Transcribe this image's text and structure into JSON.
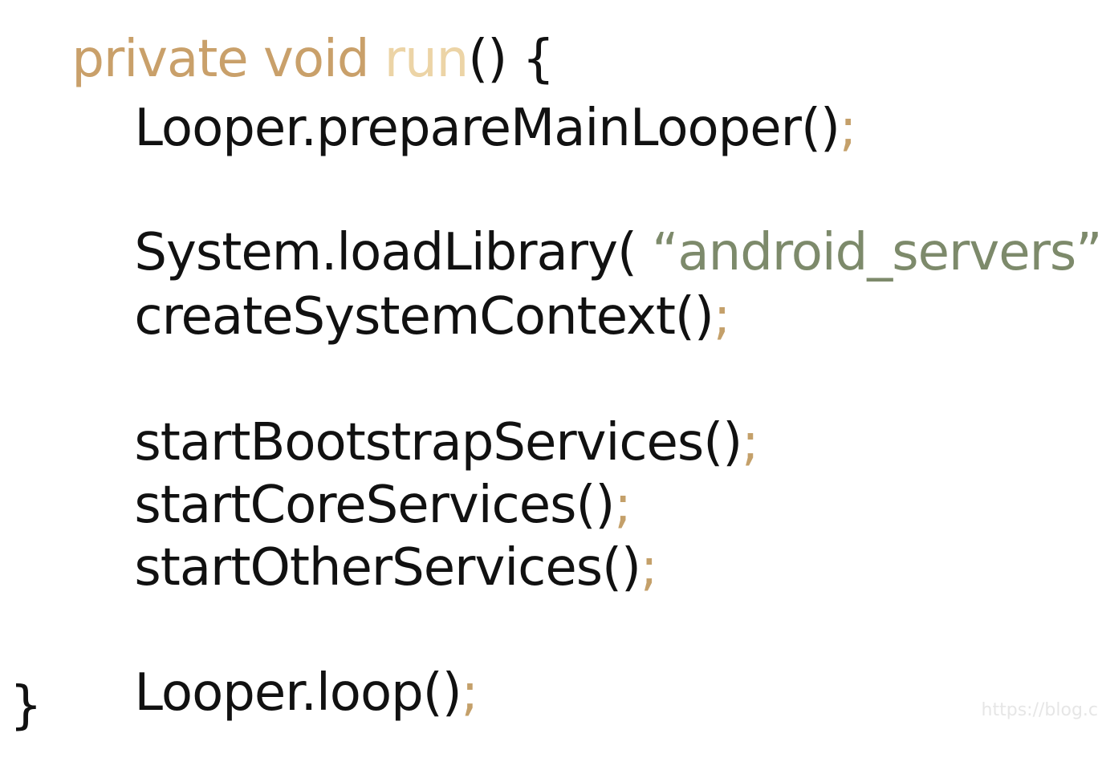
{
  "code": {
    "signature": {
      "modifiers": "private void ",
      "method_name": "run",
      "parens_brace": "() {"
    },
    "statements": [
      {
        "call": "Looper.prepareMainLooper()",
        "semicolon": ";"
      },
      {
        "call_open": "System.loadLibrary( ",
        "string_literal": "“android_servers”",
        "call_close": " )",
        "semicolon": ";"
      },
      {
        "call": "createSystemContext()",
        "semicolon": ";"
      },
      {
        "call": "startBootstrapServices()",
        "semicolon": ";"
      },
      {
        "call": "startCoreServices()",
        "semicolon": ";"
      },
      {
        "call": "startOtherServices()",
        "semicolon": ";"
      },
      {
        "call": "Looper.loop()",
        "semicolon": ";"
      }
    ],
    "closing_brace": "}"
  },
  "watermark": "https://blog.c",
  "colors": {
    "keyword": "#c9a06a",
    "method_name": "#ecd4a6",
    "semicolon": "#c4a06a",
    "string": "#7d8a6b",
    "text": "#111111"
  }
}
